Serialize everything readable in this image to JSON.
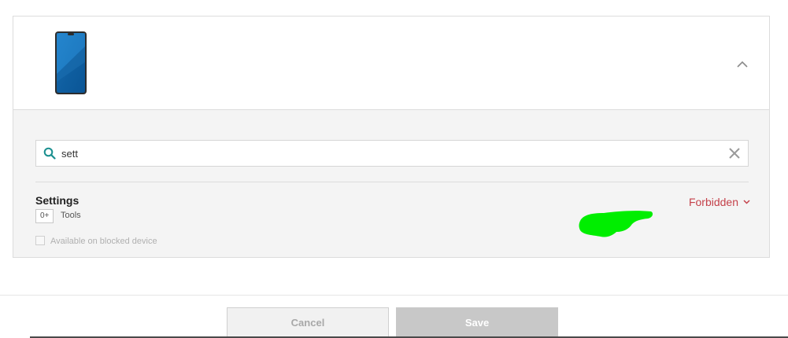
{
  "device": {
    "image_icon": "smartphone-icon"
  },
  "header": {
    "collapse_icon": "chevron-up-icon"
  },
  "search": {
    "value": "sett",
    "icon": "search-icon",
    "clear_icon": "close-icon"
  },
  "app": {
    "name": "Settings",
    "age_rating": "0+",
    "category": "Tools",
    "available_on_blocked_device_label": "Available on blocked device",
    "available_on_blocked_device_checked": false,
    "status": "Forbidden",
    "status_icon": "chevron-down-icon"
  },
  "colors": {
    "status": "#c4414a",
    "redaction": "#00ee00",
    "search_icon": "#1a8f8f"
  },
  "footer": {
    "cancel_label": "Cancel",
    "save_label": "Save"
  }
}
